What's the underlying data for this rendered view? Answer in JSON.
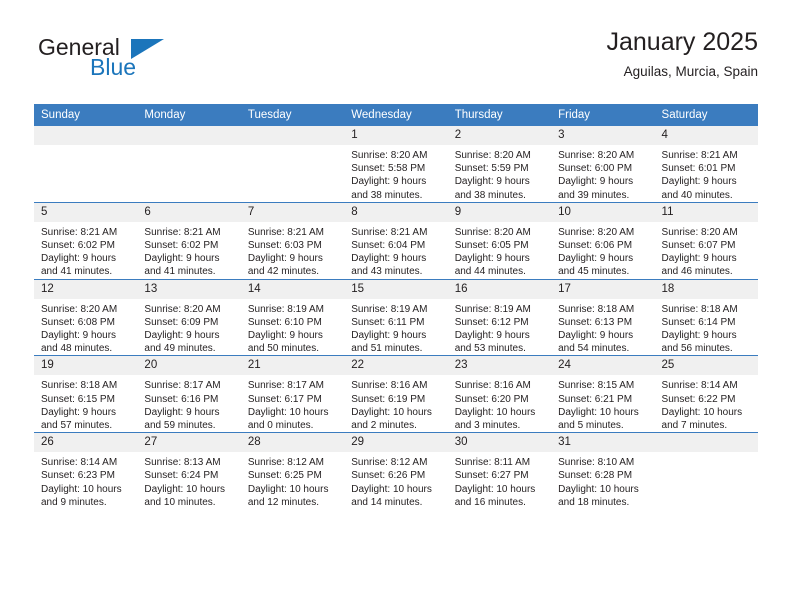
{
  "brand": {
    "name_top": "General",
    "name_bottom": "Blue",
    "accent_color": "#1b75bb"
  },
  "header": {
    "title": "January 2025",
    "subtitle": "Aguilas, Murcia, Spain"
  },
  "theme": {
    "header_row_bg": "#3b7cbf",
    "day_number_bg": "#f0f0f0",
    "text_color": "#231f20"
  },
  "weekday_headers": [
    "Sunday",
    "Monday",
    "Tuesday",
    "Wednesday",
    "Thursday",
    "Friday",
    "Saturday"
  ],
  "weeks": [
    [
      {
        "day": "",
        "sunrise": "",
        "sunset": "",
        "daylight_line1": "",
        "daylight_line2": "",
        "empty": true
      },
      {
        "day": "",
        "sunrise": "",
        "sunset": "",
        "daylight_line1": "",
        "daylight_line2": "",
        "empty": true
      },
      {
        "day": "",
        "sunrise": "",
        "sunset": "",
        "daylight_line1": "",
        "daylight_line2": "",
        "empty": true
      },
      {
        "day": "1",
        "sunrise": "Sunrise: 8:20 AM",
        "sunset": "Sunset: 5:58 PM",
        "daylight_line1": "Daylight: 9 hours",
        "daylight_line2": "and 38 minutes.",
        "empty": false
      },
      {
        "day": "2",
        "sunrise": "Sunrise: 8:20 AM",
        "sunset": "Sunset: 5:59 PM",
        "daylight_line1": "Daylight: 9 hours",
        "daylight_line2": "and 38 minutes.",
        "empty": false
      },
      {
        "day": "3",
        "sunrise": "Sunrise: 8:20 AM",
        "sunset": "Sunset: 6:00 PM",
        "daylight_line1": "Daylight: 9 hours",
        "daylight_line2": "and 39 minutes.",
        "empty": false
      },
      {
        "day": "4",
        "sunrise": "Sunrise: 8:21 AM",
        "sunset": "Sunset: 6:01 PM",
        "daylight_line1": "Daylight: 9 hours",
        "daylight_line2": "and 40 minutes.",
        "empty": false
      }
    ],
    [
      {
        "day": "5",
        "sunrise": "Sunrise: 8:21 AM",
        "sunset": "Sunset: 6:02 PM",
        "daylight_line1": "Daylight: 9 hours",
        "daylight_line2": "and 41 minutes.",
        "empty": false
      },
      {
        "day": "6",
        "sunrise": "Sunrise: 8:21 AM",
        "sunset": "Sunset: 6:02 PM",
        "daylight_line1": "Daylight: 9 hours",
        "daylight_line2": "and 41 minutes.",
        "empty": false
      },
      {
        "day": "7",
        "sunrise": "Sunrise: 8:21 AM",
        "sunset": "Sunset: 6:03 PM",
        "daylight_line1": "Daylight: 9 hours",
        "daylight_line2": "and 42 minutes.",
        "empty": false
      },
      {
        "day": "8",
        "sunrise": "Sunrise: 8:21 AM",
        "sunset": "Sunset: 6:04 PM",
        "daylight_line1": "Daylight: 9 hours",
        "daylight_line2": "and 43 minutes.",
        "empty": false
      },
      {
        "day": "9",
        "sunrise": "Sunrise: 8:20 AM",
        "sunset": "Sunset: 6:05 PM",
        "daylight_line1": "Daylight: 9 hours",
        "daylight_line2": "and 44 minutes.",
        "empty": false
      },
      {
        "day": "10",
        "sunrise": "Sunrise: 8:20 AM",
        "sunset": "Sunset: 6:06 PM",
        "daylight_line1": "Daylight: 9 hours",
        "daylight_line2": "and 45 minutes.",
        "empty": false
      },
      {
        "day": "11",
        "sunrise": "Sunrise: 8:20 AM",
        "sunset": "Sunset: 6:07 PM",
        "daylight_line1": "Daylight: 9 hours",
        "daylight_line2": "and 46 minutes.",
        "empty": false
      }
    ],
    [
      {
        "day": "12",
        "sunrise": "Sunrise: 8:20 AM",
        "sunset": "Sunset: 6:08 PM",
        "daylight_line1": "Daylight: 9 hours",
        "daylight_line2": "and 48 minutes.",
        "empty": false
      },
      {
        "day": "13",
        "sunrise": "Sunrise: 8:20 AM",
        "sunset": "Sunset: 6:09 PM",
        "daylight_line1": "Daylight: 9 hours",
        "daylight_line2": "and 49 minutes.",
        "empty": false
      },
      {
        "day": "14",
        "sunrise": "Sunrise: 8:19 AM",
        "sunset": "Sunset: 6:10 PM",
        "daylight_line1": "Daylight: 9 hours",
        "daylight_line2": "and 50 minutes.",
        "empty": false
      },
      {
        "day": "15",
        "sunrise": "Sunrise: 8:19 AM",
        "sunset": "Sunset: 6:11 PM",
        "daylight_line1": "Daylight: 9 hours",
        "daylight_line2": "and 51 minutes.",
        "empty": false
      },
      {
        "day": "16",
        "sunrise": "Sunrise: 8:19 AM",
        "sunset": "Sunset: 6:12 PM",
        "daylight_line1": "Daylight: 9 hours",
        "daylight_line2": "and 53 minutes.",
        "empty": false
      },
      {
        "day": "17",
        "sunrise": "Sunrise: 8:18 AM",
        "sunset": "Sunset: 6:13 PM",
        "daylight_line1": "Daylight: 9 hours",
        "daylight_line2": "and 54 minutes.",
        "empty": false
      },
      {
        "day": "18",
        "sunrise": "Sunrise: 8:18 AM",
        "sunset": "Sunset: 6:14 PM",
        "daylight_line1": "Daylight: 9 hours",
        "daylight_line2": "and 56 minutes.",
        "empty": false
      }
    ],
    [
      {
        "day": "19",
        "sunrise": "Sunrise: 8:18 AM",
        "sunset": "Sunset: 6:15 PM",
        "daylight_line1": "Daylight: 9 hours",
        "daylight_line2": "and 57 minutes.",
        "empty": false
      },
      {
        "day": "20",
        "sunrise": "Sunrise: 8:17 AM",
        "sunset": "Sunset: 6:16 PM",
        "daylight_line1": "Daylight: 9 hours",
        "daylight_line2": "and 59 minutes.",
        "empty": false
      },
      {
        "day": "21",
        "sunrise": "Sunrise: 8:17 AM",
        "sunset": "Sunset: 6:17 PM",
        "daylight_line1": "Daylight: 10 hours",
        "daylight_line2": "and 0 minutes.",
        "empty": false
      },
      {
        "day": "22",
        "sunrise": "Sunrise: 8:16 AM",
        "sunset": "Sunset: 6:19 PM",
        "daylight_line1": "Daylight: 10 hours",
        "daylight_line2": "and 2 minutes.",
        "empty": false
      },
      {
        "day": "23",
        "sunrise": "Sunrise: 8:16 AM",
        "sunset": "Sunset: 6:20 PM",
        "daylight_line1": "Daylight: 10 hours",
        "daylight_line2": "and 3 minutes.",
        "empty": false
      },
      {
        "day": "24",
        "sunrise": "Sunrise: 8:15 AM",
        "sunset": "Sunset: 6:21 PM",
        "daylight_line1": "Daylight: 10 hours",
        "daylight_line2": "and 5 minutes.",
        "empty": false
      },
      {
        "day": "25",
        "sunrise": "Sunrise: 8:14 AM",
        "sunset": "Sunset: 6:22 PM",
        "daylight_line1": "Daylight: 10 hours",
        "daylight_line2": "and 7 minutes.",
        "empty": false
      }
    ],
    [
      {
        "day": "26",
        "sunrise": "Sunrise: 8:14 AM",
        "sunset": "Sunset: 6:23 PM",
        "daylight_line1": "Daylight: 10 hours",
        "daylight_line2": "and 9 minutes.",
        "empty": false
      },
      {
        "day": "27",
        "sunrise": "Sunrise: 8:13 AM",
        "sunset": "Sunset: 6:24 PM",
        "daylight_line1": "Daylight: 10 hours",
        "daylight_line2": "and 10 minutes.",
        "empty": false
      },
      {
        "day": "28",
        "sunrise": "Sunrise: 8:12 AM",
        "sunset": "Sunset: 6:25 PM",
        "daylight_line1": "Daylight: 10 hours",
        "daylight_line2": "and 12 minutes.",
        "empty": false
      },
      {
        "day": "29",
        "sunrise": "Sunrise: 8:12 AM",
        "sunset": "Sunset: 6:26 PM",
        "daylight_line1": "Daylight: 10 hours",
        "daylight_line2": "and 14 minutes.",
        "empty": false
      },
      {
        "day": "30",
        "sunrise": "Sunrise: 8:11 AM",
        "sunset": "Sunset: 6:27 PM",
        "daylight_line1": "Daylight: 10 hours",
        "daylight_line2": "and 16 minutes.",
        "empty": false
      },
      {
        "day": "31",
        "sunrise": "Sunrise: 8:10 AM",
        "sunset": "Sunset: 6:28 PM",
        "daylight_line1": "Daylight: 10 hours",
        "daylight_line2": "and 18 minutes.",
        "empty": false
      },
      {
        "day": "",
        "sunrise": "",
        "sunset": "",
        "daylight_line1": "",
        "daylight_line2": "",
        "empty": true
      }
    ]
  ]
}
